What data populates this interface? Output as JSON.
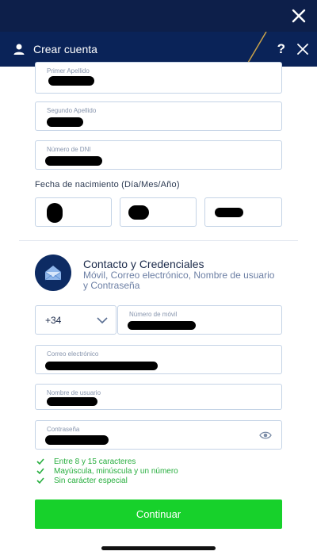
{
  "header": {
    "title": "Crear cuenta",
    "help_label": "?"
  },
  "fields": {
    "first_surname": {
      "label": "Primer Apellido",
      "value": ""
    },
    "second_surname": {
      "label": "Segundo Apellido",
      "value": ""
    },
    "dni": {
      "label": "Número de DNI",
      "value": ""
    },
    "mobile": {
      "label": "Número de móvil",
      "value": ""
    },
    "email": {
      "label": "Correo electrónico",
      "value": ""
    },
    "username": {
      "label": "Nombre de usuario",
      "value": ""
    },
    "password": {
      "label": "Contraseña",
      "value": ""
    }
  },
  "dob": {
    "label": "Fecha de nacimiento (Día/Mes/Año)",
    "day": "",
    "month": "",
    "year": ""
  },
  "contact_section": {
    "title": "Contacto y Credenciales",
    "subtitle": "Móvil, Correo electrónico, Nombre de usuario y Contraseña"
  },
  "prefix": {
    "value": "+34"
  },
  "password_rules": [
    {
      "text": "Entre 8 y 15 caracteres",
      "met": true
    },
    {
      "text": "Mayúscula, minúscula y un número",
      "met": true
    },
    {
      "text": "Sin carácter especial",
      "met": true
    }
  ],
  "continue_label": "Continuar",
  "colors": {
    "top_bar": "#0d1f4a",
    "header": "#0a2358",
    "accent_green": "#17d12b",
    "rule_green": "#27ae3e",
    "field_border": "#c4d3e6"
  }
}
